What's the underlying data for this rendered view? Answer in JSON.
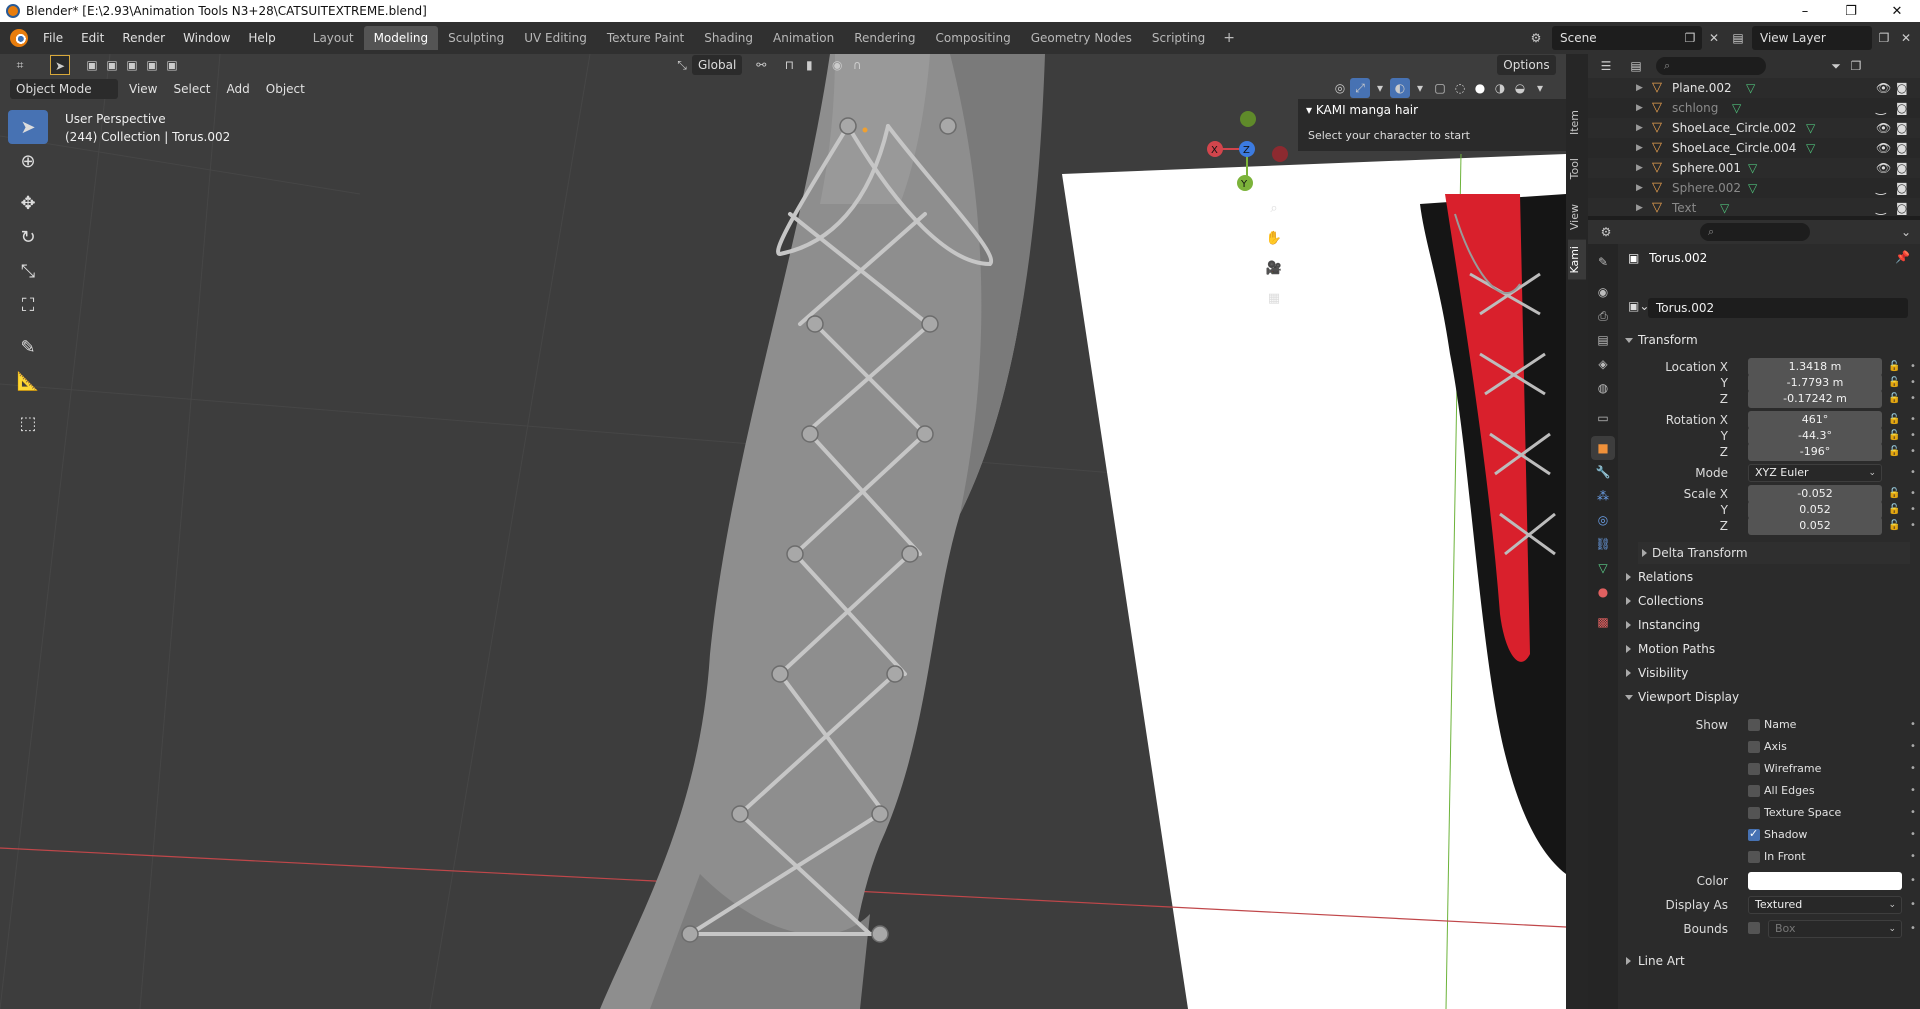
{
  "window": {
    "title": "Blender* [E:\\2.93\\Animation Tools N3+28\\CATSUITEXTREME.blend]",
    "min": "–",
    "max": "❐",
    "close": "✕"
  },
  "menu": {
    "items": [
      "File",
      "Edit",
      "Render",
      "Window",
      "Help"
    ],
    "workspaces": [
      "Layout",
      "Modeling",
      "Sculpting",
      "UV Editing",
      "Texture Paint",
      "Shading",
      "Animation",
      "Rendering",
      "Compositing",
      "Geometry Nodes",
      "Scripting"
    ],
    "active_workspace": "Modeling",
    "add": "+",
    "scene": "Scene",
    "view_layer": "View Layer"
  },
  "viewport": {
    "transform_orientation": "Global",
    "options": "Options",
    "mode": "Object Mode",
    "menus": [
      "View",
      "Select",
      "Add",
      "Object"
    ],
    "info_line1": "User Perspective",
    "info_line2": "(244) Collection | Torus.002",
    "gizmo": {
      "x": "X",
      "y": "Y",
      "z": "Z"
    }
  },
  "kami_panel": {
    "title": "KAMI manga hair",
    "message": "Select your character to start"
  },
  "side_tabs": [
    "Item",
    "Tool",
    "View",
    "Kami"
  ],
  "outliner": {
    "rows": [
      {
        "name": "Plane.002",
        "dim": false,
        "eye": "👁"
      },
      {
        "name": "schlong",
        "dim": true,
        "eye": "‿"
      },
      {
        "name": "ShoeLace_Circle.002",
        "dim": false,
        "eye": "👁"
      },
      {
        "name": "ShoeLace_Circle.004",
        "dim": false,
        "eye": "👁"
      },
      {
        "name": "Sphere.001",
        "dim": false,
        "eye": "👁"
      },
      {
        "name": "Sphere.002",
        "dim": true,
        "eye": "‿"
      },
      {
        "name": "Text",
        "dim": true,
        "eye": "‿"
      }
    ]
  },
  "properties": {
    "object_name": "Torus.002",
    "name_field": "Torus.002",
    "transform": {
      "title": "Transform",
      "location_label": "Location X",
      "location": [
        "1.3418 m",
        "-1.7793 m",
        "-0.17242 m"
      ],
      "rotation_label": "Rotation X",
      "rotation": [
        "461°",
        "-44.3°",
        "-196°"
      ],
      "mode_label": "Mode",
      "mode": "XYZ Euler",
      "scale_label": "Scale X",
      "scale": [
        "-0.052",
        "0.052",
        "0.052"
      ],
      "y": "Y",
      "z": "Z",
      "delta": "Delta Transform"
    },
    "sections": [
      "Relations",
      "Collections",
      "Instancing",
      "Motion Paths",
      "Visibility"
    ],
    "viewport_display": {
      "title": "Viewport Display",
      "show_label": "Show",
      "checks": [
        {
          "label": "Name",
          "on": false
        },
        {
          "label": "Axis",
          "on": false
        },
        {
          "label": "Wireframe",
          "on": false
        },
        {
          "label": "All Edges",
          "on": false
        },
        {
          "label": "Texture Space",
          "on": false
        },
        {
          "label": "Shadow",
          "on": true
        },
        {
          "label": "In Front",
          "on": false
        }
      ],
      "color_label": "Color",
      "display_as_label": "Display As",
      "display_as": "Textured",
      "bounds_label": "Bounds",
      "bounds": "Box"
    },
    "line_art": "Line Art"
  }
}
